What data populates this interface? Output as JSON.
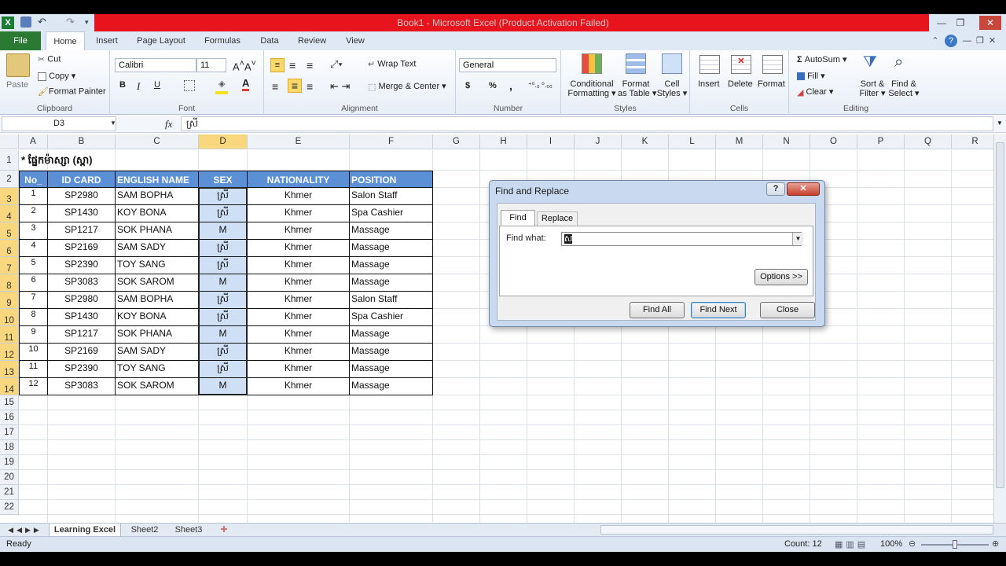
{
  "window": {
    "title": "Book1 - Microsoft Excel (Product Activation Failed)"
  },
  "tabs": [
    "File",
    "Home",
    "Insert",
    "Page Layout",
    "Formulas",
    "Data",
    "Review",
    "View"
  ],
  "ribbon": {
    "clipboard": {
      "paste": "Paste",
      "cut": "Cut",
      "copy": "Copy",
      "format_painter": "Format Painter",
      "label": "Clipboard"
    },
    "font": {
      "name": "Calibri",
      "size": "11",
      "bold": "B",
      "italic": "I",
      "underline": "U",
      "label": "Font"
    },
    "alignment": {
      "wrap": "Wrap Text",
      "merge": "Merge & Center",
      "label": "Alignment"
    },
    "number": {
      "format": "General",
      "currency": "$",
      "percent": "%",
      "comma": ",",
      "label": "Number"
    },
    "styles": {
      "conditional": "Conditional",
      "conditional2": "Formatting",
      "format_table": "Format",
      "format_table2": "as Table",
      "cell_styles": "Cell",
      "cell_styles2": "Styles",
      "label": "Styles"
    },
    "cells": {
      "insert": "Insert",
      "delete": "Delete",
      "format": "Format",
      "label": "Cells"
    },
    "editing": {
      "autosum": "AutoSum",
      "fill": "Fill",
      "clear": "Clear",
      "sort": "Sort &",
      "sort2": "Filter",
      "find": "Find &",
      "find2": "Select",
      "label": "Editing"
    }
  },
  "formula_bar": {
    "name_box": "D3",
    "fx": "fx",
    "value": "ស្រី"
  },
  "columns": [
    "A",
    "B",
    "C",
    "D",
    "E",
    "F",
    "G",
    "H",
    "I",
    "J",
    "K",
    "L",
    "M",
    "N",
    "O",
    "P",
    "Q",
    "R"
  ],
  "rows": [
    "1",
    "2",
    "3",
    "4",
    "5",
    "6",
    "7",
    "8",
    "9",
    "10",
    "11",
    "12",
    "13",
    "14",
    "15",
    "16",
    "17",
    "18",
    "19",
    "20",
    "21",
    "22"
  ],
  "sheet": {
    "title": "* ផ្នែកម៉ាស្សា (ស្ពា)",
    "headers": [
      "No_",
      "ID CARD",
      "ENGLISH NAME",
      "SEX",
      "NATIONALITY",
      "POSITION"
    ],
    "data": [
      [
        "1",
        "SP2980",
        "SAM BOPHA",
        "ស្រី",
        "Khmer",
        "Salon Staff"
      ],
      [
        "2",
        "SP1430",
        "KOY BONA",
        "ស្រី",
        "Khmer",
        "Spa Cashier"
      ],
      [
        "3",
        "SP1217",
        "SOK PHANA",
        "M",
        "Khmer",
        "Massage"
      ],
      [
        "4",
        "SP2169",
        "SAM SADY",
        "ស្រី",
        "Khmer",
        "Massage"
      ],
      [
        "5",
        "SP2390",
        "TOY SANG",
        "ស្រី",
        "Khmer",
        "Massage"
      ],
      [
        "6",
        "SP3083",
        "SOK SAROM",
        "M",
        "Khmer",
        "Massage"
      ],
      [
        "7",
        "SP2980",
        "SAM BOPHA",
        "ស្រី",
        "Khmer",
        "Salon Staff"
      ],
      [
        "8",
        "SP1430",
        "KOY BONA",
        "ស្រី",
        "Khmer",
        "Spa Cashier"
      ],
      [
        "9",
        "SP1217",
        "SOK PHANA",
        "M",
        "Khmer",
        "Massage"
      ],
      [
        "10",
        "SP2169",
        "SAM SADY",
        "ស្រី",
        "Khmer",
        "Massage"
      ],
      [
        "11",
        "SP2390",
        "TOY SANG",
        "ស្រី",
        "Khmer",
        "Massage"
      ],
      [
        "12",
        "SP3083",
        "SOK SAROM",
        "M",
        "Khmer",
        "Massage"
      ]
    ]
  },
  "sheet_tabs": [
    "Learning Excel",
    "Sheet2",
    "Sheet3"
  ],
  "status": {
    "ready": "Ready",
    "count": "Count: 12",
    "zoom": "100%"
  },
  "dialog": {
    "title": "Find and Replace",
    "help": "?",
    "close_x": "✕",
    "tab_find": "Find",
    "tab_replace": "Replace",
    "find_label": "Find what:",
    "find_value": "ស",
    "options": "Options >>",
    "find_all": "Find All",
    "find_next": "Find Next",
    "close": "Close"
  }
}
